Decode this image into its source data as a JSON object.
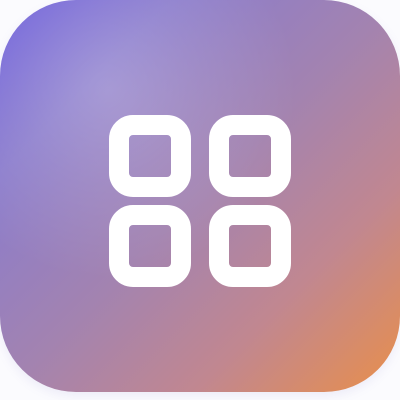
{
  "app_icon": {
    "icon": "grid-2x2-icon",
    "gradient": [
      "#6d5fdb",
      "#a383b0",
      "#e98f4a"
    ],
    "glyph_color": "#ffffff"
  }
}
